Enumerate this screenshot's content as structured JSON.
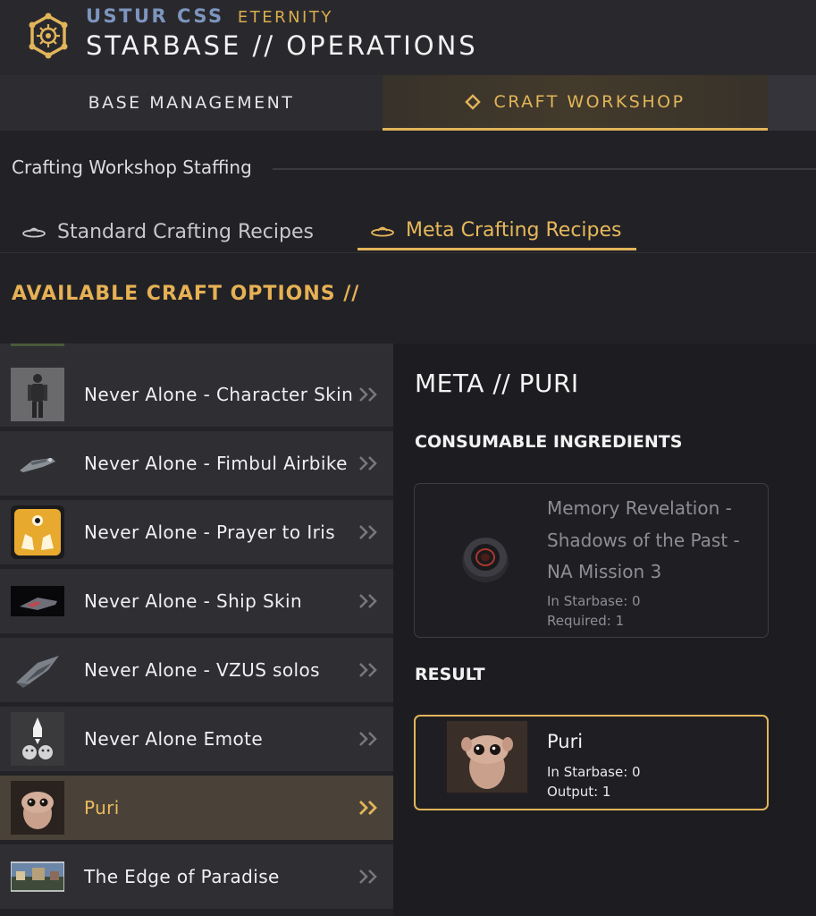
{
  "header": {
    "org_name": "USTUR CSS",
    "org_tier": "ETERNITY",
    "page_title": "STARBASE // OPERATIONS",
    "logo_icon": "hex-star-emblem-icon"
  },
  "main_tabs": {
    "base": "BASE MANAGEMENT",
    "craft": "CRAFT WORKSHOP",
    "craft_icon": "diamond-icon"
  },
  "staffing_label": "Crafting Workshop Staffing",
  "sub_tabs": {
    "standard": "Standard Crafting Recipes",
    "meta": "Meta Crafting Recipes",
    "icon": "ufo-icon"
  },
  "available_heading": "AVAILABLE CRAFT OPTIONS //",
  "recipes": [
    {
      "label": "Never Alone - Character Skin",
      "thumb": "character-skin-thumb"
    },
    {
      "label": "Never Alone - Fimbul Airbike",
      "thumb": "airbike-thumb"
    },
    {
      "label": "Never Alone - Prayer to Iris",
      "thumb": "prayer-to-iris-thumb"
    },
    {
      "label": "Never Alone - Ship Skin",
      "thumb": "ship-skin-thumb"
    },
    {
      "label": "Never Alone - VZUS solos",
      "thumb": "vzus-solos-thumb"
    },
    {
      "label": "Never Alone Emote",
      "thumb": "emote-thumb"
    },
    {
      "label": "Puri",
      "thumb": "puri-thumb",
      "selected": true
    },
    {
      "label": "The Edge of Paradise",
      "thumb": "edge-of-paradise-thumb"
    }
  ],
  "detail": {
    "title": "META // PURI",
    "ingredients_heading": "CONSUMABLE INGREDIENTS",
    "ingredient": {
      "name": "Memory Revelation - Shadows of the Past - NA Mission 3",
      "in_starbase": "In Starbase: 0",
      "required": "Required: 1",
      "icon": "memory-disc-icon"
    },
    "result_heading": "RESULT",
    "result": {
      "name": "Puri",
      "in_starbase": "In Starbase: 0",
      "output": "Output: 1",
      "icon": "puri-creature-icon"
    }
  },
  "colors": {
    "accent": "#e2b55a",
    "org_blue": "#7d95c0",
    "panel": "#2e2e33",
    "selected": "#4a4238",
    "detail_bg": "#1d1d21"
  }
}
